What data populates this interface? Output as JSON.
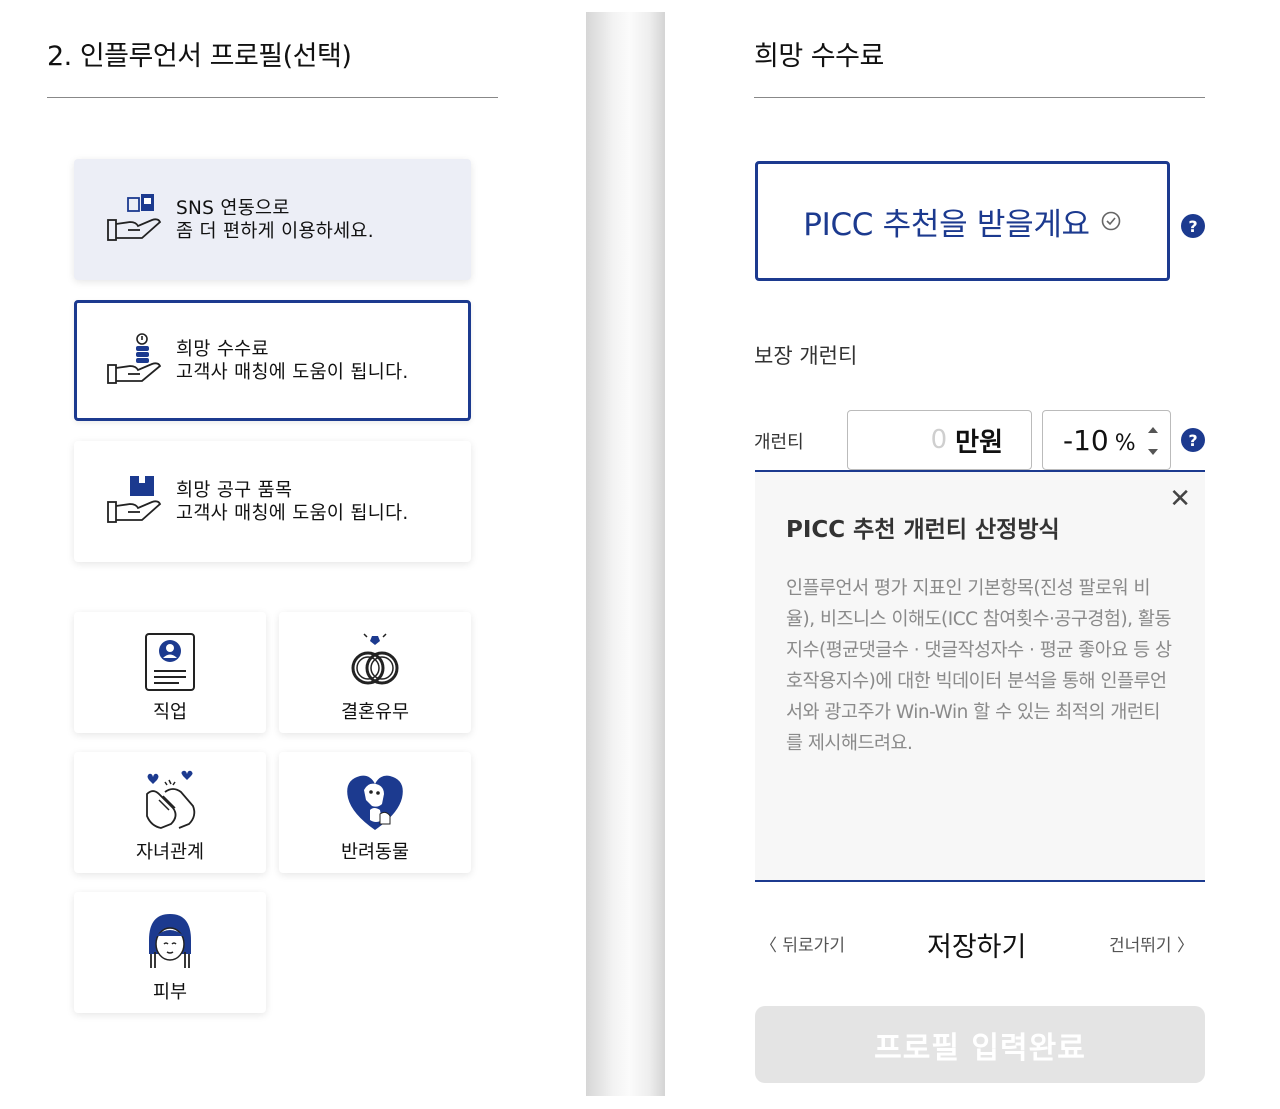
{
  "left": {
    "title": "2. 인플루언서 프로필(선택)",
    "cards": [
      {
        "line1": "SNS 연동으로",
        "line2": "좀 더 편하게 이용하세요.",
        "icon": "hand-phone-icon"
      },
      {
        "line1": "희망 수수료",
        "line2": "고객사 매칭에 도움이 됩니다.",
        "icon": "hand-coins-icon"
      },
      {
        "line1": "희망 공구 품목",
        "line2": "고객사 매칭에 도움이 됩니다.",
        "icon": "hand-box-icon"
      }
    ],
    "tiles": [
      {
        "label": "직업",
        "icon": "id-card-icon"
      },
      {
        "label": "결혼유무",
        "icon": "rings-icon"
      },
      {
        "label": "자녀관계",
        "icon": "hands-hearts-icon"
      },
      {
        "label": "반려동물",
        "icon": "pets-heart-icon"
      },
      {
        "label": "피부",
        "icon": "face-skin-icon"
      }
    ]
  },
  "right": {
    "title": "희망 수수료",
    "picc_button": "PICC 추천을 받을게요",
    "guarantee_section": "보장 개런티",
    "guarantee_label": "개런티",
    "amount_value": "0",
    "amount_unit": "만원",
    "percent_value": "-10",
    "percent_unit": "%",
    "help_symbol": "?",
    "info": {
      "title": "PICC 추천 개런티 산정방식",
      "body": "인플루언서 평가 지표인 기본항목(진성 팔로워 비율), 비즈니스 이해도(ICC 참여횟수·공구경험), 활동지수(평균댓글수 · 댓글작성자수 · 평균 좋아요 등 상호작용지수)에 대한 빅데이터 분석을 통해 인플루언서와 광고주가 Win-Win 할 수 있는 최적의 개런티를 제시해드려요.",
      "close": "✕"
    },
    "nav": {
      "back": "〈 뒤로가기",
      "save": "저장하기",
      "skip": "건너뛰기 〉"
    },
    "submit": "프로필 입력완료"
  },
  "colors": {
    "accent": "#1c3a8f",
    "card_highlight": "#eceef6",
    "disabled": "#e4e4e4"
  }
}
